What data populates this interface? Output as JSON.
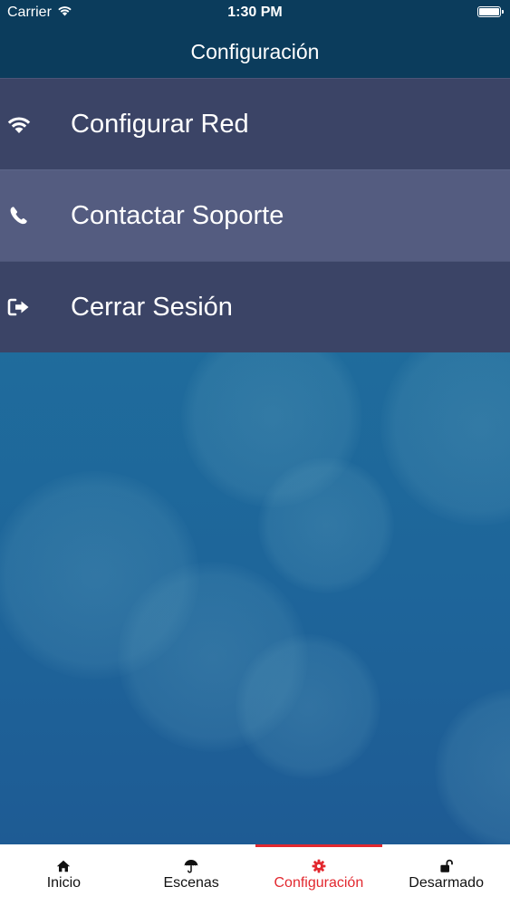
{
  "status_bar": {
    "carrier": "Carrier",
    "time": "1:30 PM"
  },
  "nav_bar": {
    "title": "Configuración"
  },
  "menu": {
    "items": [
      {
        "label": "Configurar Red",
        "icon": "wifi-icon"
      },
      {
        "label": "Contactar Soporte",
        "icon": "phone-icon"
      },
      {
        "label": "Cerrar Sesión",
        "icon": "logout-icon"
      }
    ],
    "selected_index": 1
  },
  "tab_bar": {
    "tabs": [
      {
        "label": "Inicio",
        "icon": "home-icon"
      },
      {
        "label": "Escenas",
        "icon": "umbrella-icon"
      },
      {
        "label": "Configuración",
        "icon": "gear-icon"
      },
      {
        "label": "Desarmado",
        "icon": "unlock-icon"
      }
    ],
    "active_index": 2
  },
  "colors": {
    "nav_background": "#0b3c5c",
    "menu_item": "#3b4466",
    "menu_item_selected": "#545c80",
    "accent": "#e2282f",
    "background": "#1e6b9b"
  }
}
